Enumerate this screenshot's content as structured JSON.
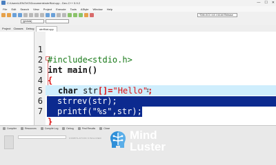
{
  "window": {
    "title": "C:\\Users\\LENOVO\\Documents\\strrfNot.cpp - Dev-C++ 5.9.2",
    "controls": [
      "—",
      "☐",
      "✕"
    ]
  },
  "menu": [
    "File",
    "Edit",
    "Search",
    "View",
    "Project",
    "Execute",
    "Tools",
    "AStyle",
    "Window",
    "Help"
  ],
  "toolbar": {
    "compiler": "TDM-GCC 4.8.1 64-bit Release",
    "scope": "(globals)"
  },
  "project_panel": {
    "tabs": [
      "Project",
      "Classes",
      "Debug"
    ]
  },
  "editor": {
    "file_tab": "strrfNot.cpp",
    "lines": [
      {
        "n": "1",
        "text": "#include<stdio.h>"
      },
      {
        "n": "2",
        "text": "int main()"
      },
      {
        "n": "3",
        "text": "{"
      },
      {
        "n": "4",
        "text": "char str[]=\"Hello\";"
      },
      {
        "n": "5",
        "text": "strrev(str);"
      },
      {
        "n": "6",
        "text": "printf(\"%s\",str);"
      },
      {
        "n": "7",
        "text": "}"
      }
    ],
    "tokens": {
      "include": "#include<stdio.h>",
      "int": "int",
      "main": " main()",
      "brace_open": "{",
      "char": "char",
      "str_decl": " str",
      "brackets_eq": "[]=",
      "hello": "\"Hello\"",
      "semi": ";",
      "strrev": "strrev(str);",
      "printf_a": "printf(",
      "fmt": "\"%s\"",
      "printf_b": ",str);",
      "brace_close": "}"
    },
    "cursor_glyph": "I"
  },
  "bottom_panel": {
    "tabs": [
      "Compiler",
      "Resources",
      "Compile Log",
      "Debug",
      "Find Results",
      "Close"
    ],
    "log_text": "COMPILATION FINALIZED"
  },
  "watermark": {
    "line1": "Mind",
    "line2": "Luster"
  },
  "colors": {
    "selection": "#0c2a8f",
    "current_line": "#cfeefd",
    "string": "#dd1111",
    "preprocessor": "#1a7a1a",
    "watermark_logo": "#2f8fd8"
  }
}
